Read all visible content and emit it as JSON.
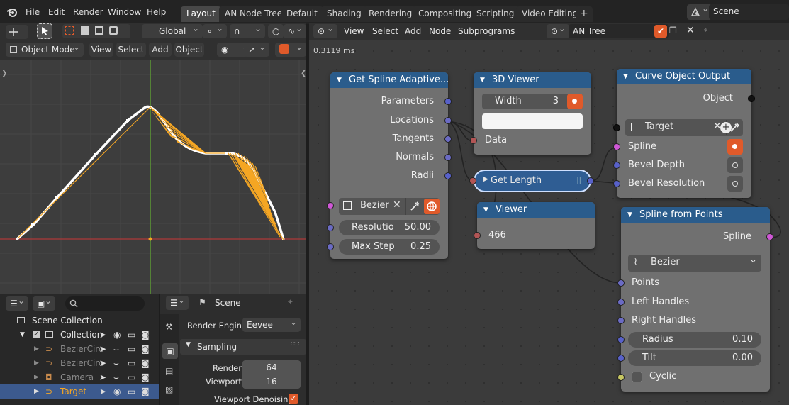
{
  "topbar": {
    "menus": [
      "File",
      "Edit",
      "Render",
      "Window",
      "Help"
    ],
    "workspace_tabs": [
      "Layout",
      "AN Node Tree",
      "Default",
      "Shading",
      "Rendering",
      "Compositing",
      "Scripting",
      "Video Editing"
    ],
    "active_tab": "Layout",
    "add_tab": "+",
    "scene_label": "Scene"
  },
  "viewport_header": {
    "orientation": "Global",
    "mode": "Object Mode",
    "menus": [
      "View",
      "Select",
      "Add",
      "Object"
    ]
  },
  "node_editor": {
    "menus": [
      "View",
      "Select",
      "Add",
      "Node",
      "Subprograms"
    ],
    "tree_name": "AN Tree",
    "timing": "0.3119 ms",
    "nodes": {
      "get_spline": {
        "title": "Get Spline Adaptive...",
        "outputs": [
          "Parameters",
          "Locations",
          "Tangents",
          "Normals",
          "Radii"
        ],
        "spline_type": "Bezier",
        "resolution_label": "Resolutio",
        "resolution_value": "50.00",
        "max_step_label": "Max Step",
        "max_step_value": "0.25"
      },
      "viewer3d": {
        "title": "3D Viewer",
        "width_label": "Width",
        "width_value": "3",
        "input": "Data"
      },
      "get_length": {
        "title": "Get Length"
      },
      "viewer": {
        "title": "Viewer",
        "value": "466"
      },
      "curve_output": {
        "title": "Curve Object Output",
        "object_label": "Object",
        "target": "Target",
        "inputs": [
          "Spline",
          "Bevel Depth",
          "Bevel Resolution"
        ]
      },
      "spline_from_points": {
        "title": "Spline from Points",
        "output": "Spline",
        "type": "Bezier",
        "inputs": [
          "Points",
          "Left Handles",
          "Right Handles"
        ],
        "radius_label": "Radius",
        "radius_value": "0.10",
        "tilt_label": "Tilt",
        "tilt_value": "0.00",
        "cyclic_label": "Cyclic"
      }
    }
  },
  "outliner": {
    "root": "Scene Collection",
    "collection": "Collection",
    "items": [
      "BezierCirc",
      "BezierCirc",
      "Camera",
      "Target"
    ],
    "selected": "Target"
  },
  "properties": {
    "scene_label": "Scene",
    "render_engine_label": "Render Engine",
    "render_engine_value": "Eevee",
    "section": "Sampling",
    "render_label": "Render",
    "render_value": "64",
    "viewport_label": "Viewport",
    "viewport_value": "16",
    "denoise_label": "Viewport Denoising"
  },
  "colors": {
    "accent": "#e05a2a",
    "node_header": "#2a5c8c",
    "spline": "#f5a623",
    "selection": "#3c5a8e"
  }
}
